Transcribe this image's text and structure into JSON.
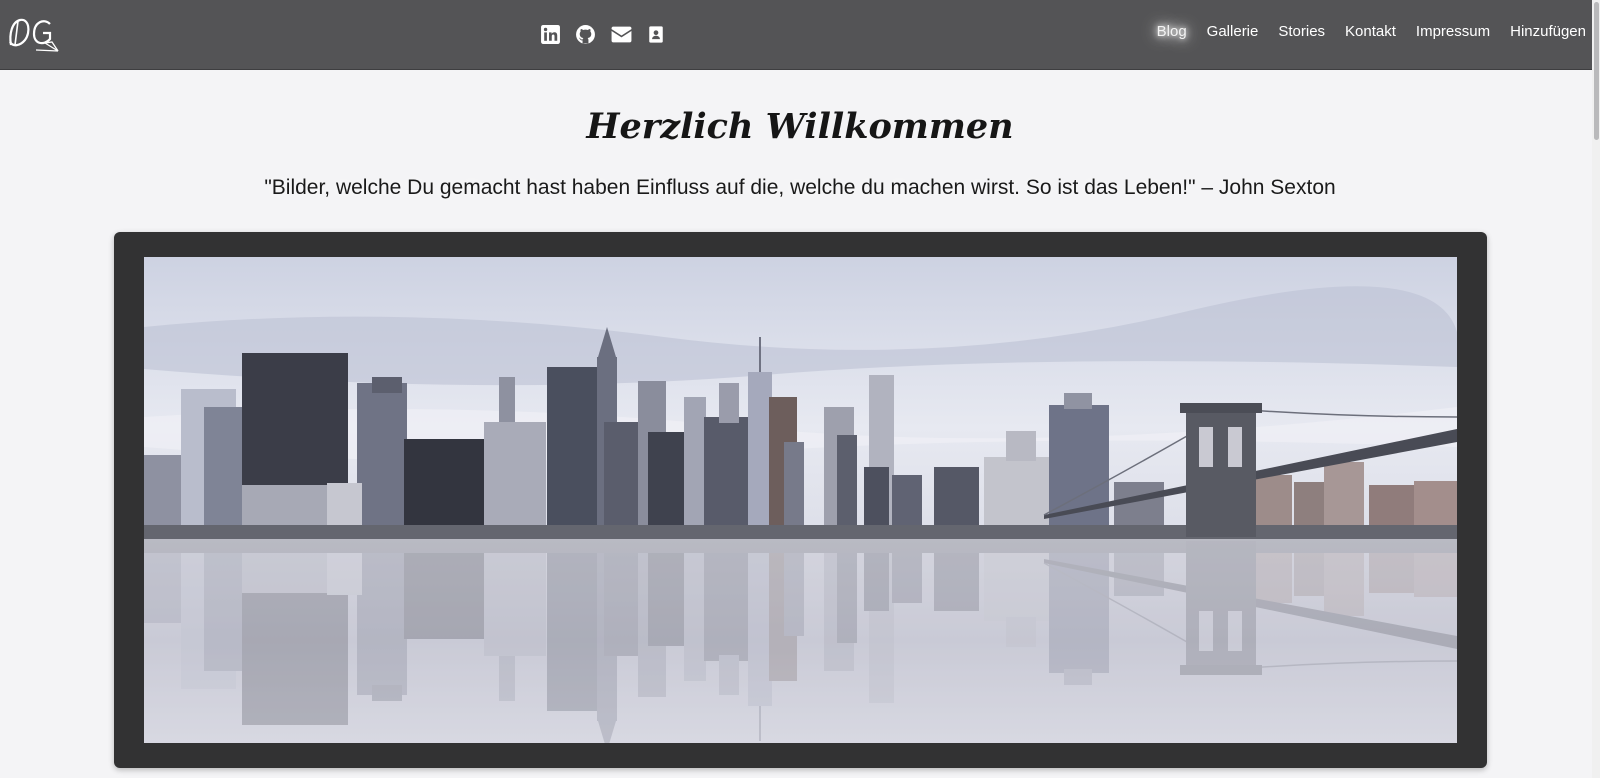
{
  "header": {
    "logo_text": "DG",
    "social_icons": [
      "linkedin-icon",
      "github-icon",
      "envelope-icon",
      "contact-card-icon"
    ],
    "nav": [
      {
        "label": "Blog",
        "active": true
      },
      {
        "label": "Gallerie"
      },
      {
        "label": "Stories"
      },
      {
        "label": "Kontakt"
      },
      {
        "label": "Impressum"
      },
      {
        "label": "Hinzufügen"
      }
    ]
  },
  "main": {
    "title": "Herzlich Willkommen",
    "quote": "\"Bilder, welche Du gemacht hast haben Einfluss auf die, welche du machen wirst. So ist das Leben!\" – John Sexton"
  },
  "colors": {
    "navbar": "#545456",
    "page_background": "#f4f4f6",
    "frame": "#323233"
  }
}
